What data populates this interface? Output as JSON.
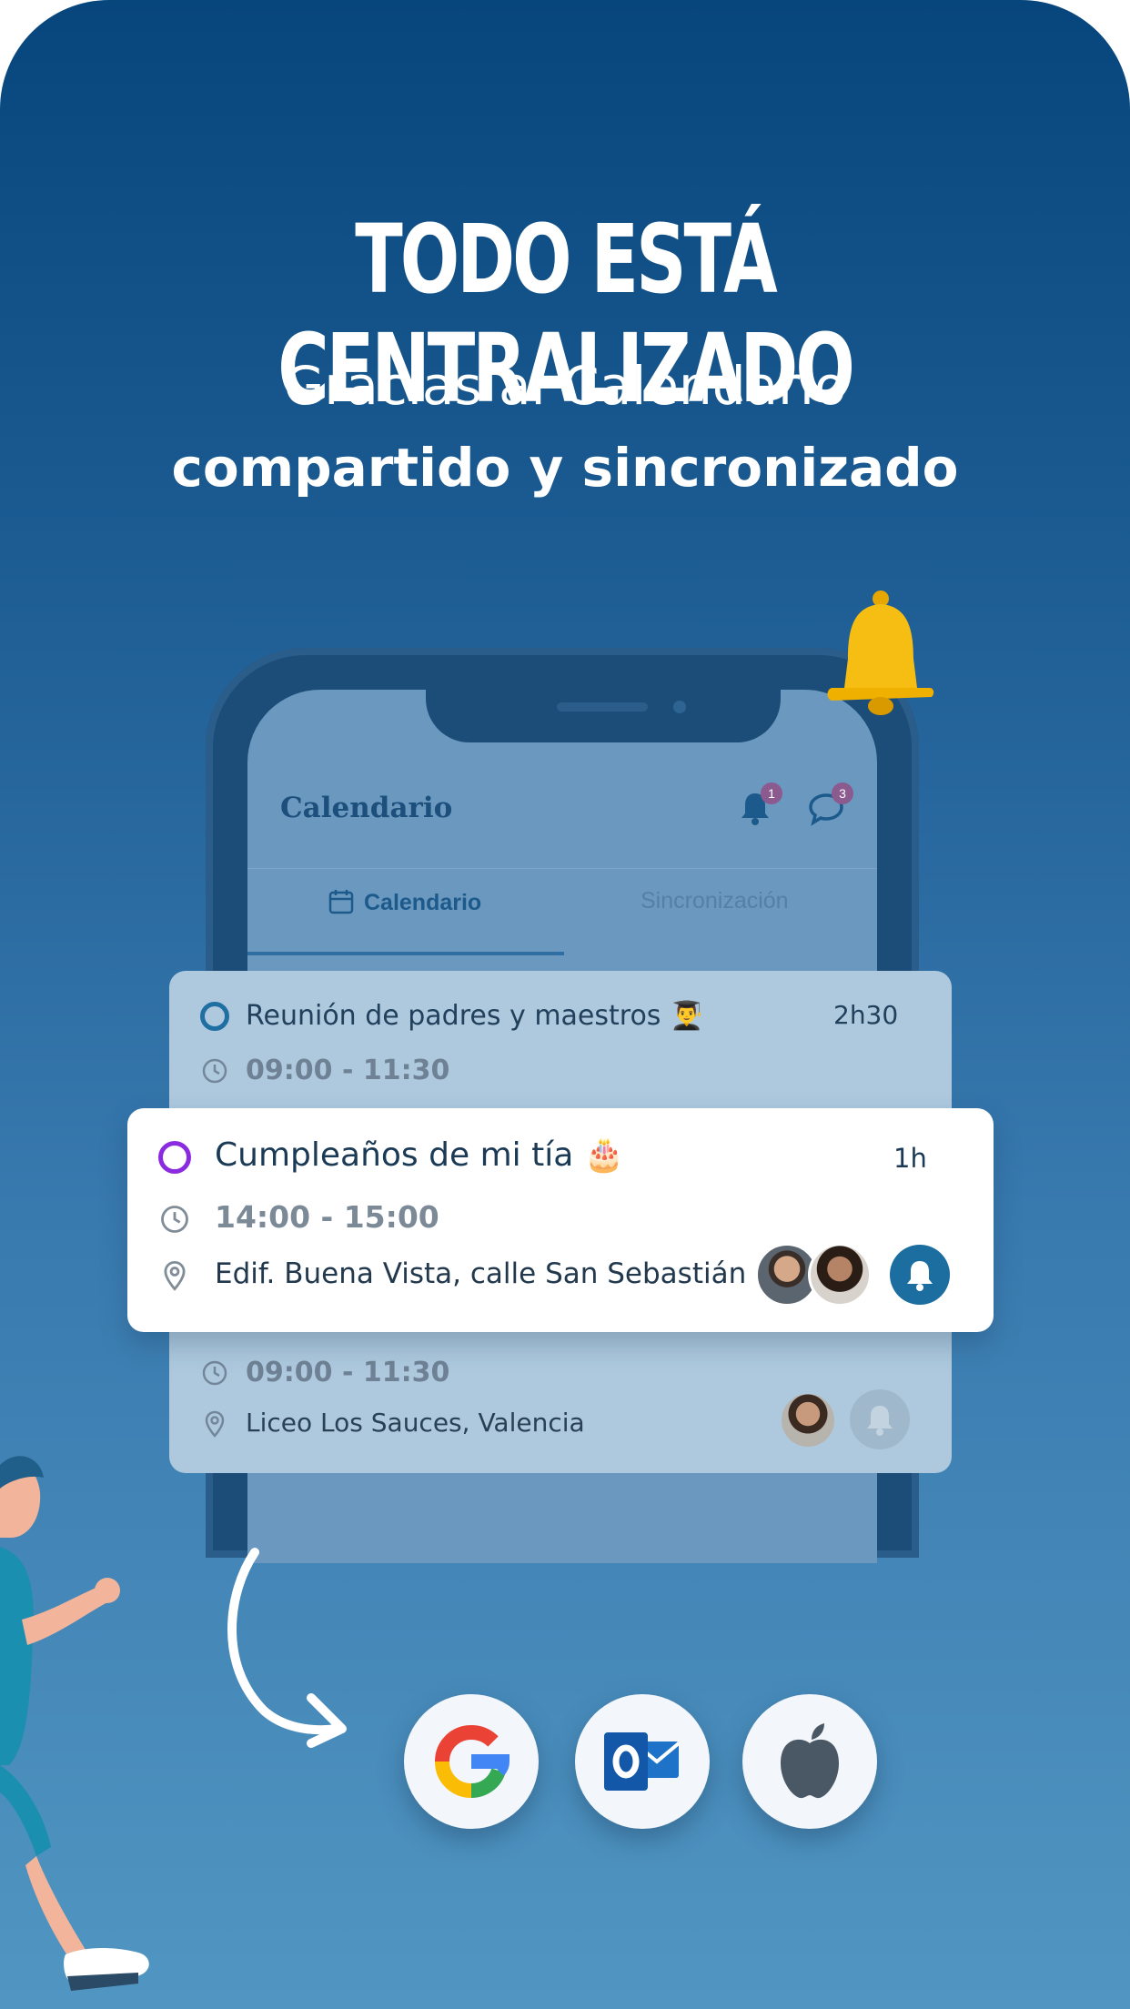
{
  "header": {
    "headline": "TODO ESTÁ CENTRALIZADO",
    "subtitle_line1": "Gracias al Calendario",
    "subtitle_line2": "compartido y sincronizado"
  },
  "app": {
    "title": "Calendario",
    "notifications_badge": "1",
    "messages_badge": "3",
    "tabs": [
      {
        "label": "Calendario",
        "active": true
      },
      {
        "label": "Sincronización",
        "active": false
      }
    ]
  },
  "events": {
    "back_top": {
      "title": "Reunión de padres y maestros 👨‍🎓",
      "duration": "2h30",
      "time": "09:00 - 11:30"
    },
    "front": {
      "title": "Cumpleaños de mi tía 🎂",
      "duration": "1h",
      "time": "14:00 - 15:00",
      "location": "Edif. Buena Vista, calle San Sebastián"
    },
    "back_bottom": {
      "time": "09:00 - 11:30",
      "location": "Liceo Los Sauces, Valencia"
    }
  },
  "integrations": [
    {
      "name": "google-icon"
    },
    {
      "name": "outlook-icon"
    },
    {
      "name": "apple-icon"
    }
  ],
  "colors": {
    "bg_top": "#07467c",
    "bg_bottom": "#5196c2",
    "accent_blue": "#1c6da0",
    "accent_purple": "#8a2be2",
    "bell_gold": "#f5b800"
  }
}
